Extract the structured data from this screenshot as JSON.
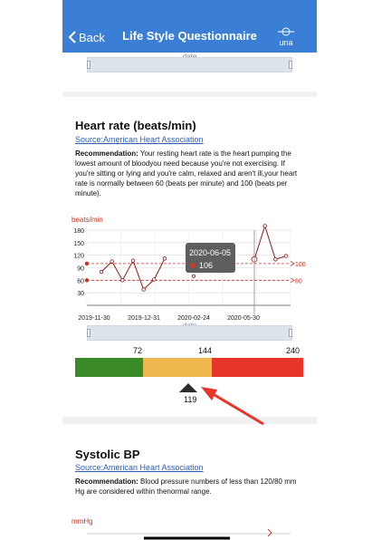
{
  "header": {
    "back_label": "Back",
    "title": "Life Style Questionnaire",
    "lang_label": "una"
  },
  "top_card": {
    "slider_label": "date"
  },
  "heart": {
    "title": "Heart rate (beats/min)",
    "source": "Source:American Heart Association",
    "rec_label": "Recommendation:",
    "rec_text": " Your resting heart rate is the heart pumping the lowest amount of bloodyou need because you're not exercising. If you're sitting or lying and you're calm, relaxed and aren't ill,your heart rate is normally between 60 (beats per minute) and 100 (beats per minute).",
    "unit": "beats/min",
    "slider_label": "date",
    "tooltip_date": "2020-06-05",
    "tooltip_value": "106",
    "scale": {
      "t1": "72",
      "t2": "144",
      "t3": "240",
      "current": "119"
    }
  },
  "bp": {
    "title": "Systolic BP",
    "source": "Source:American Heart Association",
    "rec_label": "Recommendation:",
    "rec_text": " Blood pressure numbers of less than 120/80 mm Hg are considered within thenormal range.",
    "unit": "mmHg"
  },
  "colors": {
    "line": "#8b1a1a",
    "threshold": "#c0392b",
    "appbar": "#3a7fd5"
  },
  "chart_data": {
    "type": "line",
    "ylabel": "beats/min",
    "xlabel": "date",
    "ylim": [
      0,
      180
    ],
    "yticks": [
      "180",
      "150",
      "120",
      "90",
      "60",
      "30"
    ],
    "xticks": [
      "2019-11-30",
      "2019-12-31",
      "2020-02-24",
      "2020-05-30"
    ],
    "series": [
      {
        "values": [
          80,
          105,
          60,
          107,
          38,
          62,
          112
        ]
      },
      {
        "values": [
          110,
          190,
          110,
          118
        ]
      }
    ],
    "isolated_point": 70,
    "thresholds": [
      {
        "value": 100,
        "label": "100"
      },
      {
        "value": 60,
        "label": "60"
      }
    ]
  }
}
